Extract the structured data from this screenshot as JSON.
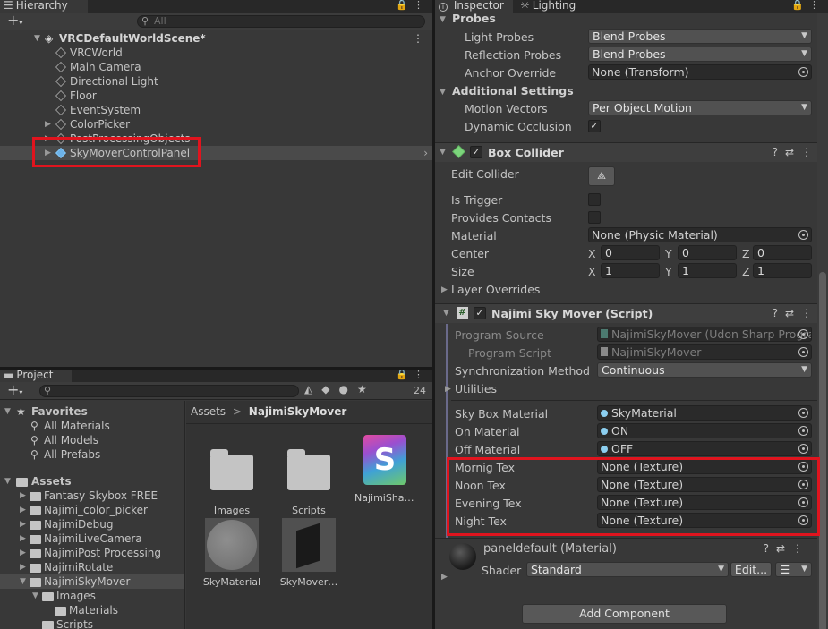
{
  "hierarchy": {
    "tab_label": "Hierarchy",
    "search_placeholder": "All",
    "scene_name": "VRCDefaultWorldScene*",
    "items": [
      {
        "label": "VRCWorld"
      },
      {
        "label": "Main Camera"
      },
      {
        "label": "Directional Light"
      },
      {
        "label": "Floor"
      },
      {
        "label": "EventSystem"
      },
      {
        "label": "ColorPicker"
      },
      {
        "label": "PostProcessingObjects"
      },
      {
        "label": "SkyMoverControlPanel"
      }
    ]
  },
  "project": {
    "tab_label": "Project",
    "hidden_count": "24",
    "favorites": {
      "label": "Favorites",
      "items": [
        "All Materials",
        "All Models",
        "All Prefabs"
      ]
    },
    "assets": {
      "label": "Assets",
      "folders": [
        "Fantasy Skybox FREE",
        "Najimi_color_picker",
        "NajimiDebug",
        "NajimiLiveCamera",
        "NajimiPost Processing",
        "NajimiRotate",
        "NajimiSkyMover"
      ],
      "subfolders": [
        "Images",
        "Materials",
        "Scripts"
      ]
    },
    "breadcrumb": {
      "root": "Assets",
      "sep": ">",
      "current": "NajimiSkyMover"
    },
    "grid": [
      {
        "label": "Images",
        "icon": "folder-icon"
      },
      {
        "label": "Scripts",
        "icon": "folder-icon"
      },
      {
        "label": "NajimiSha…",
        "icon": "shader-icon",
        "glyph": "S"
      },
      {
        "label": "SkyMaterial",
        "icon": "material-sphere-icon"
      },
      {
        "label": "SkyMover…",
        "icon": "mesh-icon"
      }
    ]
  },
  "inspector": {
    "tabs": [
      {
        "label": "Inspector"
      },
      {
        "label": "Lighting"
      }
    ],
    "probes": {
      "title": "Probes",
      "light_probes_label": "Light Probes",
      "light_probes_value": "Blend Probes",
      "reflection_probes_label": "Reflection Probes",
      "reflection_probes_value": "Blend Probes",
      "anchor_override_label": "Anchor Override",
      "anchor_override_value": "None (Transform)"
    },
    "additional": {
      "title": "Additional Settings",
      "motion_vectors_label": "Motion Vectors",
      "motion_vectors_value": "Per Object Motion",
      "dynamic_occlusion_label": "Dynamic Occlusion",
      "dynamic_occlusion_checked": true
    },
    "box_collider": {
      "title": "Box Collider",
      "edit_collider_label": "Edit Collider",
      "is_trigger_label": "Is Trigger",
      "provides_contacts_label": "Provides Contacts",
      "material_label": "Material",
      "material_value": "None (Physic Material)",
      "center_label": "Center",
      "center": {
        "x": "0",
        "y": "0",
        "z": "0"
      },
      "size_label": "Size",
      "size": {
        "x": "1",
        "y": "1",
        "z": "1"
      },
      "axis_x": "X",
      "axis_y": "Y",
      "axis_z": "Z",
      "layer_overrides_label": "Layer Overrides"
    },
    "script": {
      "title": "Najimi Sky Mover (Script)",
      "program_source_label": "Program Source",
      "program_source_value": "NajimiSkyMover (Udon Sharp Progra",
      "program_script_label": "Program Script",
      "program_script_value": "NajimiSkyMover",
      "sync_method_label": "Synchronization Method",
      "sync_method_value": "Continuous",
      "utilities_label": "Utilities",
      "fields": [
        {
          "label": "Sky Box Material",
          "value": "SkyMaterial",
          "has_dot": true
        },
        {
          "label": "On Material",
          "value": "ON",
          "has_dot": true
        },
        {
          "label": "Off Material",
          "value": "OFF",
          "has_dot": true
        },
        {
          "label": "Mornig Tex",
          "value": "None (Texture)",
          "has_dot": false
        },
        {
          "label": "Noon Tex",
          "value": "None (Texture)",
          "has_dot": false
        },
        {
          "label": "Evening Tex",
          "value": "None (Texture)",
          "has_dot": false
        },
        {
          "label": "Night Tex",
          "value": "None (Texture)",
          "has_dot": false
        }
      ]
    },
    "material": {
      "title": "paneldefault (Material)",
      "shader_label": "Shader",
      "shader_value": "Standard",
      "edit_label": "Edit..."
    },
    "add_component_label": "Add Component"
  },
  "colors": {
    "highlight_red": "#e0141e",
    "panel_bg": "#383838",
    "selection": "#4a4a4a"
  }
}
